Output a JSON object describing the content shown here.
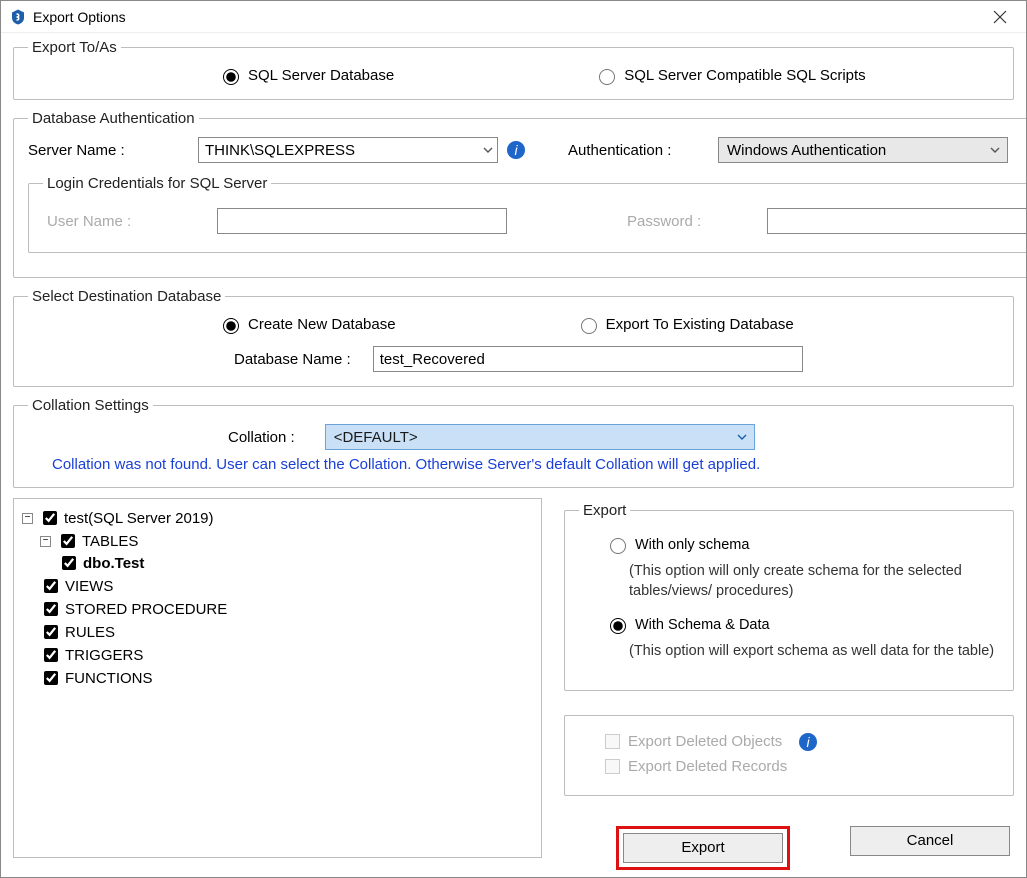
{
  "window": {
    "title": "Export Options"
  },
  "exportTo": {
    "legend": "Export To/As",
    "opt1": "SQL Server Database",
    "opt2": "SQL Server Compatible SQL Scripts",
    "selected": "opt1"
  },
  "auth": {
    "legend": "Database Authentication",
    "serverLabel": "Server Name :",
    "serverValue": "THINK\\SQLEXPRESS",
    "authLabel": "Authentication :",
    "authValue": "Windows Authentication",
    "loginLegend": "Login Credentials for SQL Server",
    "userLabel": "User Name :",
    "userValue": "",
    "passLabel": "Password :",
    "passValue": ""
  },
  "dest": {
    "legend": "Select Destination Database",
    "opt1": "Create New Database",
    "opt2": "Export To Existing Database",
    "selected": "opt1",
    "dbNameLabel": "Database Name :",
    "dbNameValue": "test_Recovered"
  },
  "collation": {
    "legend": "Collation Settings",
    "label": "Collation :",
    "value": "<DEFAULT>",
    "note": "Collation was not found. User can select the Collation. Otherwise Server's default Collation will get applied."
  },
  "tree": {
    "root": "test(SQL Server 2019)",
    "tables": "TABLES",
    "table1": "dbo.Test",
    "views": "VIEWS",
    "sp": "STORED PROCEDURE",
    "rules": "RULES",
    "triggers": "TRIGGERS",
    "functions": "FUNCTIONS"
  },
  "exportPanel": {
    "legend": "Export",
    "opt1": "With only schema",
    "opt1desc": "(This option will only create schema for the  selected tables/views/ procedures)",
    "opt2": "With Schema & Data",
    "opt2desc": "(This option will export schema as well data for the table)",
    "selected": "opt2",
    "chk1": "Export Deleted Objects",
    "chk2": "Export Deleted Records"
  },
  "buttons": {
    "export": "Export",
    "cancel": "Cancel"
  }
}
